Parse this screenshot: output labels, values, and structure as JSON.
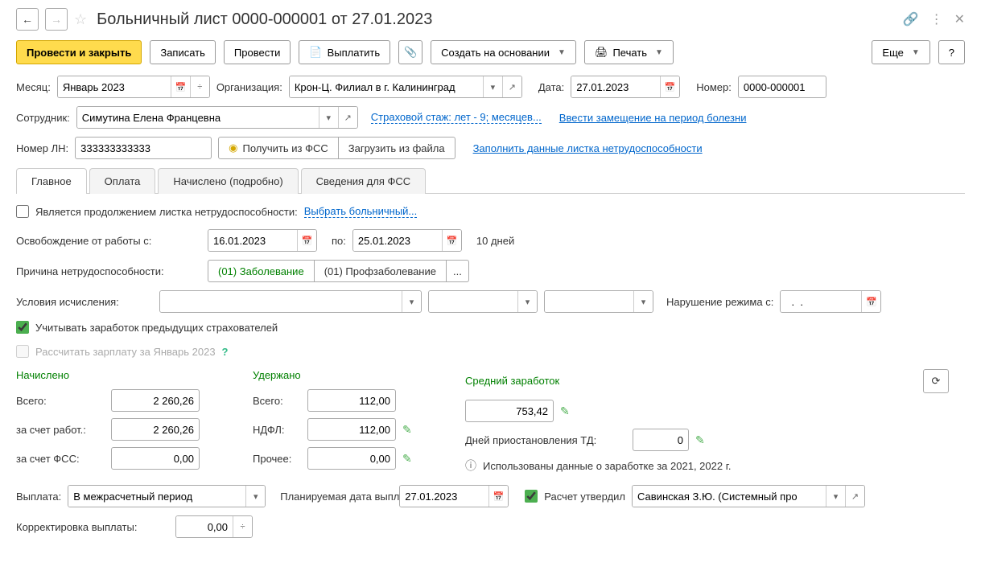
{
  "title": "Больничный лист 0000-000001 от 27.01.2023",
  "toolbar": {
    "post_close": "Провести и закрыть",
    "save": "Записать",
    "post": "Провести",
    "pay": "Выплатить",
    "create_based": "Создать на основании",
    "print": "Печать",
    "more": "Еще",
    "help": "?"
  },
  "header": {
    "month_label": "Месяц:",
    "month_value": "Январь 2023",
    "org_label": "Организация:",
    "org_value": "Крон-Ц. Филиал в г. Калининград",
    "date_label": "Дата:",
    "date_value": "27.01.2023",
    "number_label": "Номер:",
    "number_value": "0000-000001",
    "employee_label": "Сотрудник:",
    "employee_value": "Симутина Елена Францевна",
    "insurance_link": "Страховой стаж: лет - 9; месяцев...",
    "substitution_link": "Ввести замещение на период болезни",
    "ln_label": "Номер ЛН:",
    "ln_value": "333333333333",
    "get_fss": "Получить из ФСС",
    "load_file": "Загрузить из файла",
    "fill_data_link": "Заполнить данные листка нетрудоспособности"
  },
  "tabs": {
    "main": "Главное",
    "payment": "Оплата",
    "accrued": "Начислено (подробно)",
    "fss_info": "Сведения для ФСС"
  },
  "main": {
    "continuation_label": "Является продолжением листка нетрудоспособности:",
    "select_sicklist": "Выбрать больничный...",
    "release_label": "Освобождение от работы с:",
    "release_from": "16.01.2023",
    "release_to_label": "по:",
    "release_to": "25.01.2023",
    "days_text": "10 дней",
    "reason_label": "Причина нетрудоспособности:",
    "reason_active": "(01) Заболевание",
    "reason_other": "(01) Профзаболевание",
    "reason_more": "...",
    "conditions_label": "Условия исчисления:",
    "regime_label": "Нарушение режима с:",
    "regime_value": "  .  .    ",
    "prev_insurers": "Учитывать заработок предыдущих страхователей",
    "calc_salary": "Рассчитать зарплату за Январь 2023",
    "accrued_head": "Начислено",
    "withheld_head": "Удержано",
    "avg_earnings_head": "Средний заработок",
    "total_label": "Всего:",
    "accrued_total": "2 260,26",
    "employer_label": "за счет работ.:",
    "employer_value": "2 260,26",
    "fss_label": "за счет ФСС:",
    "fss_value": "0,00",
    "withheld_total": "112,00",
    "ndfl_label": "НДФЛ:",
    "ndfl_value": "112,00",
    "other_label": "Прочее:",
    "other_value": "0,00",
    "avg_value": "753,42",
    "td_days_label": "Дней приостановления ТД:",
    "td_days_value": "0",
    "data_used": "Использованы данные о заработке за  2021,  2022 г.",
    "payout_label": "Выплата:",
    "payout_value": "В межрасчетный период",
    "planned_date_label": "Планируемая дата выплаты:",
    "planned_date_value": "27.01.2023",
    "approved_label": "Расчет утвердил",
    "approved_value": "Савинская З.Ю. (Системный про",
    "correction_label": "Корректировка выплаты:",
    "correction_value": "0,00"
  }
}
